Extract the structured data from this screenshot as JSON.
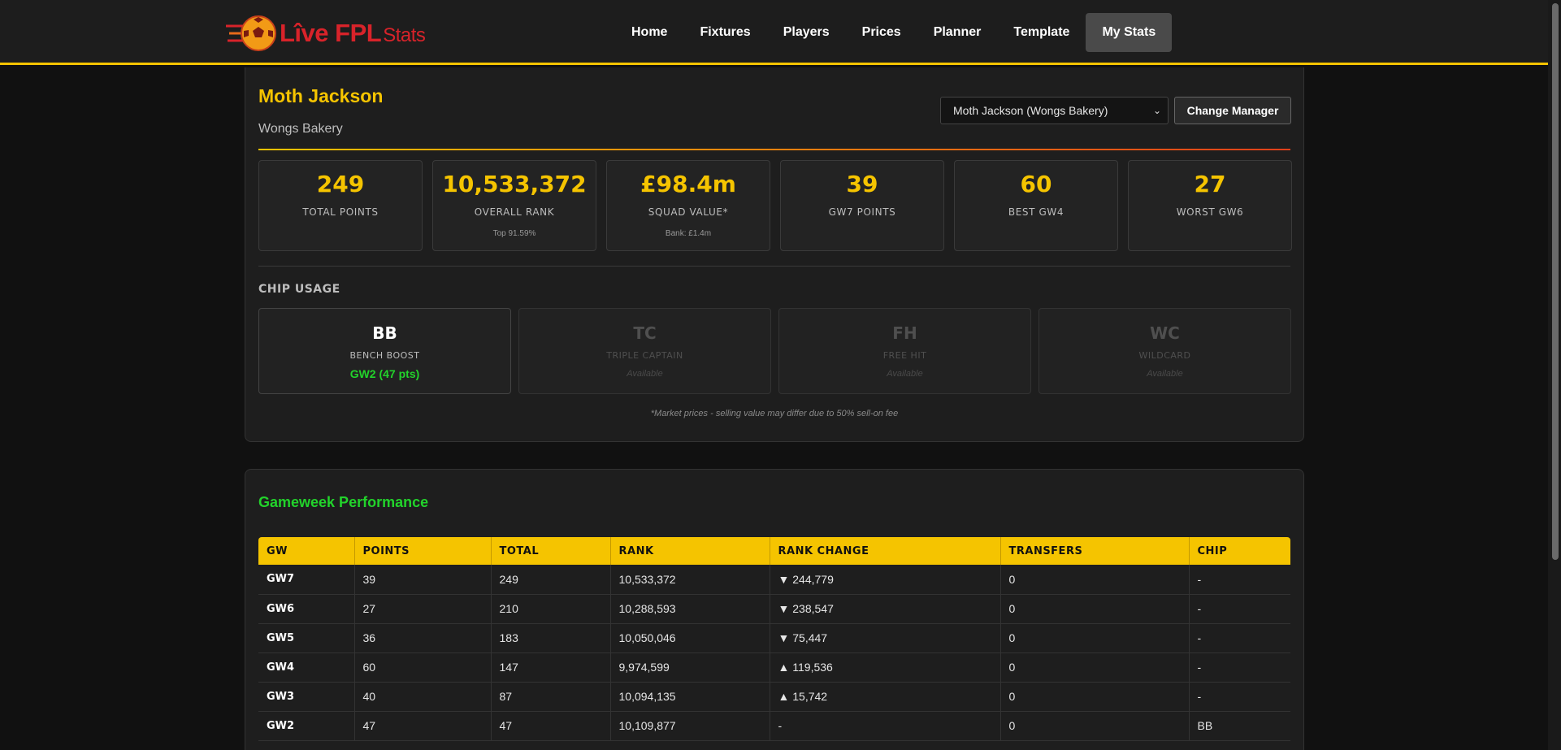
{
  "header": {
    "logo_main": "Lîve FPL",
    "logo_sub": "Stats",
    "nav": [
      {
        "label": "Home"
      },
      {
        "label": "Fixtures"
      },
      {
        "label": "Players"
      },
      {
        "label": "Prices"
      },
      {
        "label": "Planner"
      },
      {
        "label": "Template"
      },
      {
        "label": "My Stats",
        "active": true
      }
    ]
  },
  "manager": {
    "name": "Moth Jackson",
    "team": "Wongs Bakery",
    "select_value": "Moth Jackson (Wongs Bakery)",
    "change_label": "Change Manager"
  },
  "stats": [
    {
      "value": "249",
      "label": "TOTAL POINTS",
      "sub": ""
    },
    {
      "value": "10,533,372",
      "label": "OVERALL RANK",
      "sub": "Top 91.59%"
    },
    {
      "value": "£98.4m",
      "label": "SQUAD VALUE*",
      "sub": "Bank: £1.4m"
    },
    {
      "value": "39",
      "label": "GW7 POINTS",
      "sub": ""
    },
    {
      "value": "60",
      "label": "BEST GW4",
      "sub": ""
    },
    {
      "value": "27",
      "label": "WORST GW6",
      "sub": ""
    }
  ],
  "chips": {
    "title": "CHIP USAGE",
    "items": [
      {
        "code": "BB",
        "name": "BENCH BOOST",
        "status": "GW2 (47 pts)",
        "used": true
      },
      {
        "code": "TC",
        "name": "TRIPLE CAPTAIN",
        "status": "Available",
        "used": false
      },
      {
        "code": "FH",
        "name": "FREE HIT",
        "status": "Available",
        "used": false
      },
      {
        "code": "WC",
        "name": "WILDCARD",
        "status": "Available",
        "used": false
      }
    ]
  },
  "footnote": "*Market prices - selling value may differ due to 50% sell-on fee",
  "gameweek": {
    "title": "Gameweek Performance",
    "columns": [
      "GW",
      "POINTS",
      "TOTAL",
      "RANK",
      "RANK CHANGE",
      "TRANSFERS",
      "CHIP"
    ],
    "rows": [
      {
        "gw": "GW7",
        "points": "39",
        "total": "249",
        "rank": "10,533,372",
        "change": "244,779",
        "dir": "down",
        "transfers": "0",
        "chip": "-"
      },
      {
        "gw": "GW6",
        "points": "27",
        "total": "210",
        "rank": "10,288,593",
        "change": "238,547",
        "dir": "down",
        "transfers": "0",
        "chip": "-"
      },
      {
        "gw": "GW5",
        "points": "36",
        "total": "183",
        "rank": "10,050,046",
        "change": "75,447",
        "dir": "down",
        "transfers": "0",
        "chip": "-"
      },
      {
        "gw": "GW4",
        "points": "60",
        "total": "147",
        "rank": "9,974,599",
        "change": "119,536",
        "dir": "up",
        "transfers": "0",
        "chip": "-"
      },
      {
        "gw": "GW3",
        "points": "40",
        "total": "87",
        "rank": "10,094,135",
        "change": "15,742",
        "dir": "up",
        "transfers": "0",
        "chip": "-"
      },
      {
        "gw": "GW2",
        "points": "47",
        "total": "47",
        "rank": "10,109,877",
        "change": "-",
        "dir": "none",
        "transfers": "0",
        "chip": "BB"
      }
    ]
  },
  "colors": {
    "accent": "#f5c400",
    "positive": "#22d32b",
    "negative": "#ff3b1f",
    "brand": "#d8232a"
  }
}
